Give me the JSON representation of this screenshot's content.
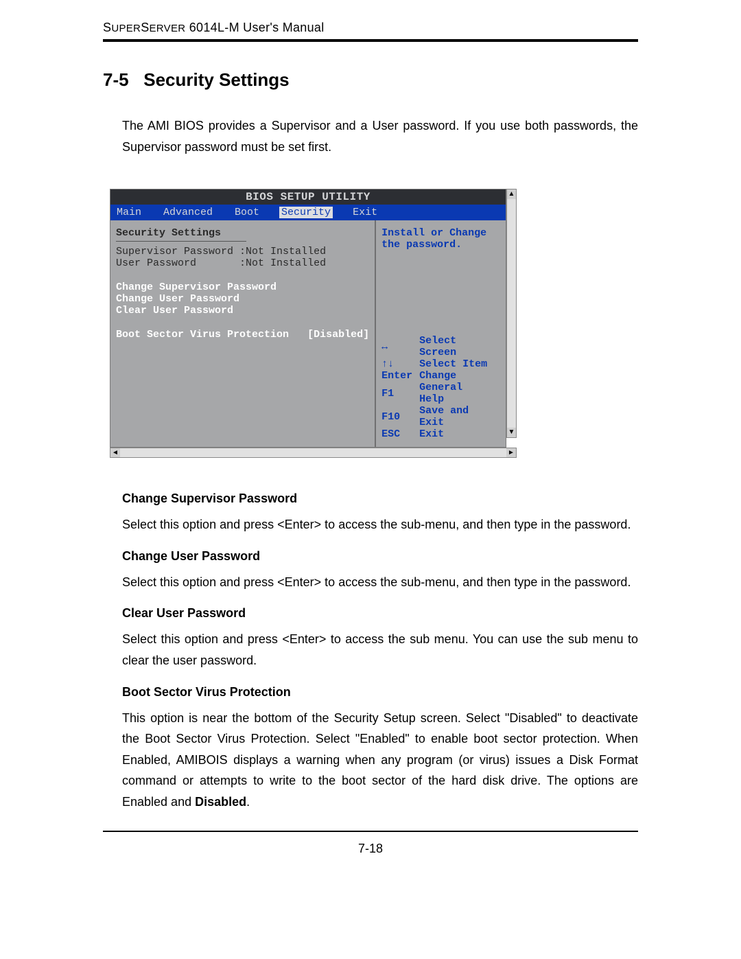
{
  "header": {
    "product_smallcaps_1": "S",
    "product_rest_1": "UPER",
    "product_smallcaps_2": "S",
    "product_rest_2": "ERVER",
    "model": " 6014L-M User's Manual"
  },
  "section": {
    "number": "7-5",
    "title": "Security Settings"
  },
  "intro": "The AMI BIOS provides a Supervisor and a User password. If you use both passwords, the Supervisor password must be set first.",
  "bios": {
    "window_title": "BIOS SETUP UTILITY",
    "menu": [
      "Main",
      "Advanced",
      "Boot",
      "Security",
      "Exit"
    ],
    "selected_menu_index": 3,
    "left": {
      "heading": "Security Settings",
      "supervisor_label": "Supervisor Password",
      "supervisor_value": ":Not Installed",
      "user_label": "User Password",
      "user_value": ":Not Installed",
      "items": [
        "Change Supervisor Password",
        "Change User Password",
        "Clear User Password"
      ],
      "bsvp_label": "Boot Sector Virus Protection",
      "bsvp_value": "[Disabled]"
    },
    "right": {
      "help_text": "Install or Change the password.",
      "hints": [
        {
          "key": "↔",
          "action": "Select Screen"
        },
        {
          "key": "↑↓",
          "action": "Select Item"
        },
        {
          "key": "Enter",
          "action": "Change"
        },
        {
          "key": "F1",
          "action": "General Help"
        },
        {
          "key": "F10",
          "action": "Save and Exit"
        },
        {
          "key": "ESC",
          "action": "Exit"
        }
      ]
    }
  },
  "subs": [
    {
      "title": "Change Supervisor Password",
      "body": "Select this option and press <Enter> to access the sub-menu, and then type in the password."
    },
    {
      "title": "Change User Password",
      "body": "Select this option and press <Enter> to access the sub-menu, and then type in the password."
    },
    {
      "title": "Clear User Password",
      "body": "Select this option and press <Enter> to access the sub menu. You can use the sub menu to clear the user password."
    },
    {
      "title": "Boot Sector Virus Protection",
      "body_pre": "This option is near the bottom of the Security Setup screen. Select \"Disabled\"  to deactivate the Boot Sector Virus Protection. Select \"Enabled\" to enable boot sector protection. When Enabled, AMIBOIS displays a warning when any program (or virus) issues a Disk Format command or attempts to write to the boot sector of the hard disk drive.  The options are Enabled and ",
      "body_bold": "Disabled",
      "body_post": "."
    }
  ],
  "page_number": "7-18"
}
